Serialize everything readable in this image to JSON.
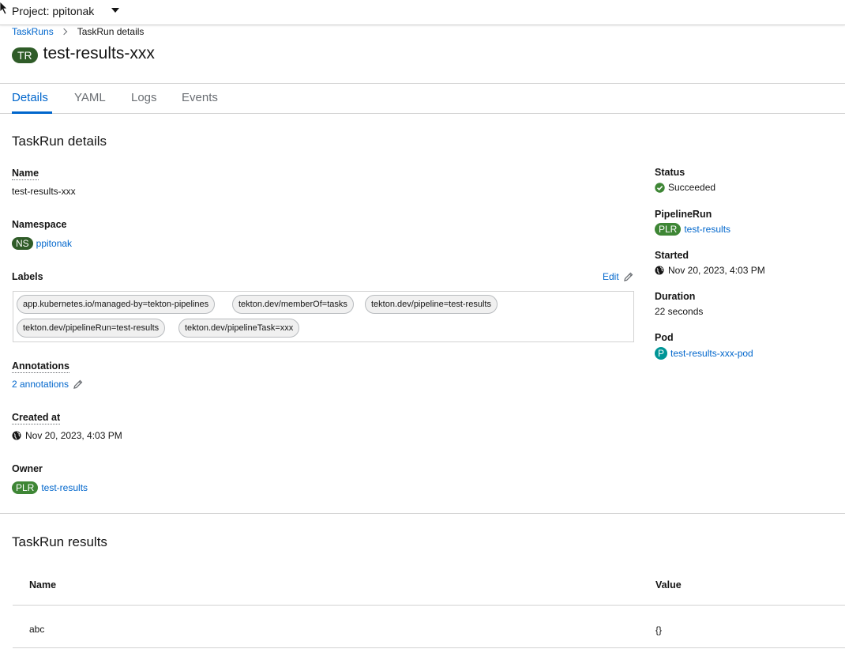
{
  "header": {
    "project_label": "Project: ppitonak"
  },
  "breadcrumb": {
    "parent": "TaskRuns",
    "current": "TaskRun details"
  },
  "resource": {
    "badge": "TR",
    "name": "test-results-xxx"
  },
  "tabs": [
    "Details",
    "YAML",
    "Logs",
    "Events"
  ],
  "details": {
    "heading": "TaskRun details",
    "name_label": "Name",
    "name_value": "test-results-xxx",
    "namespace_label": "Namespace",
    "namespace_badge": "NS",
    "namespace_value": "ppitonak",
    "labels_label": "Labels",
    "edit_label": "Edit",
    "labels": [
      "app.kubernetes.io/managed-by=tekton-pipelines",
      "tekton.dev/memberOf=tasks",
      "tekton.dev/pipeline=test-results",
      "tekton.dev/pipelineRun=test-results",
      "tekton.dev/pipelineTask=xxx"
    ],
    "annotations_label": "Annotations",
    "annotations_value": "2 annotations",
    "created_label": "Created at",
    "created_value": "Nov 20, 2023, 4:03 PM",
    "owner_label": "Owner",
    "owner_badge": "PLR",
    "owner_value": "test-results"
  },
  "side": {
    "status_label": "Status",
    "status_value": "Succeeded",
    "pipelinerun_label": "PipelineRun",
    "pipelinerun_badge": "PLR",
    "pipelinerun_value": "test-results",
    "started_label": "Started",
    "started_value": "Nov 20, 2023, 4:03 PM",
    "duration_label": "Duration",
    "duration_value": "22 seconds",
    "pod_label": "Pod",
    "pod_badge": "P",
    "pod_value": "test-results-xxx-pod"
  },
  "results": {
    "heading": "TaskRun results",
    "columns": [
      "Name",
      "Value"
    ],
    "rows": [
      {
        "name": "abc",
        "value": "{}"
      }
    ]
  },
  "colors": {
    "link": "#0066cc",
    "badge_green": "#3e8635",
    "badge_teal": "#009596",
    "success": "#3e8635"
  }
}
